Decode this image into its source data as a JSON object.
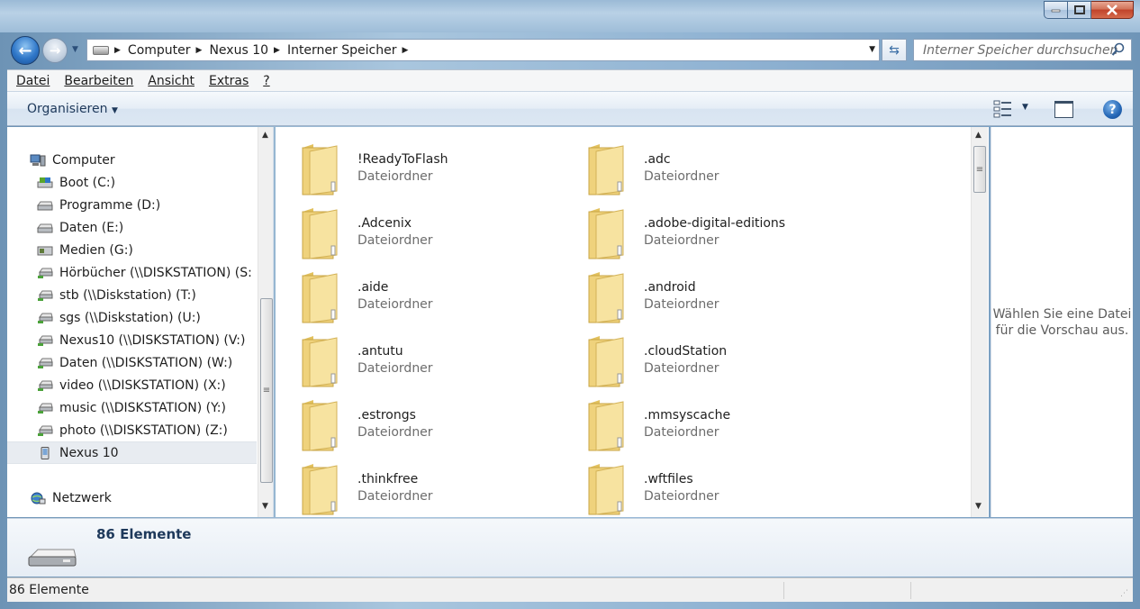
{
  "addressbar": {
    "crumbs": [
      "Computer",
      "Nexus 10",
      "Interner Speicher"
    ],
    "search_placeholder": "Interner Speicher durchsuchen"
  },
  "menubar": {
    "items": [
      "Datei",
      "Bearbeiten",
      "Ansicht",
      "Extras",
      "?"
    ]
  },
  "commandbar": {
    "organize_label": "Organisieren"
  },
  "navpane": {
    "computer": "Computer",
    "drives": [
      "Boot (C:)",
      "Programme (D:)",
      "Daten (E:)",
      "Medien (G:)",
      "Hörbücher (\\\\DISKSTATION) (S:",
      "stb (\\\\Diskstation) (T:)",
      "sgs (\\\\Diskstation) (U:)",
      "Nexus10 (\\\\DISKSTATION) (V:)",
      "Daten (\\\\DISKSTATION) (W:)",
      "video (\\\\DISKSTATION) (X:)",
      "music (\\\\DISKSTATION) (Y:)",
      "photo (\\\\DISKSTATION) (Z:)",
      "Nexus 10"
    ],
    "network": "Netzwerk"
  },
  "content": {
    "items": [
      {
        "name": "!ReadyToFlash",
        "type": "Dateiordner"
      },
      {
        "name": ".adc",
        "type": "Dateiordner"
      },
      {
        "name": ".Adcenix",
        "type": "Dateiordner"
      },
      {
        "name": ".adobe-digital-editions",
        "type": "Dateiordner"
      },
      {
        "name": ".aide",
        "type": "Dateiordner"
      },
      {
        "name": ".android",
        "type": "Dateiordner"
      },
      {
        "name": ".antutu",
        "type": "Dateiordner"
      },
      {
        "name": ".cloudStation",
        "type": "Dateiordner"
      },
      {
        "name": ".estrongs",
        "type": "Dateiordner"
      },
      {
        "name": ".mmsyscache",
        "type": "Dateiordner"
      },
      {
        "name": ".thinkfree",
        "type": "Dateiordner"
      },
      {
        "name": ".wftfiles",
        "type": "Dateiordner"
      }
    ]
  },
  "preview": {
    "line1": "Wählen Sie eine Datei",
    "line2": "für die Vorschau aus."
  },
  "details": {
    "count": "86 Elemente"
  },
  "statusbar": {
    "text": "86 Elemente"
  }
}
